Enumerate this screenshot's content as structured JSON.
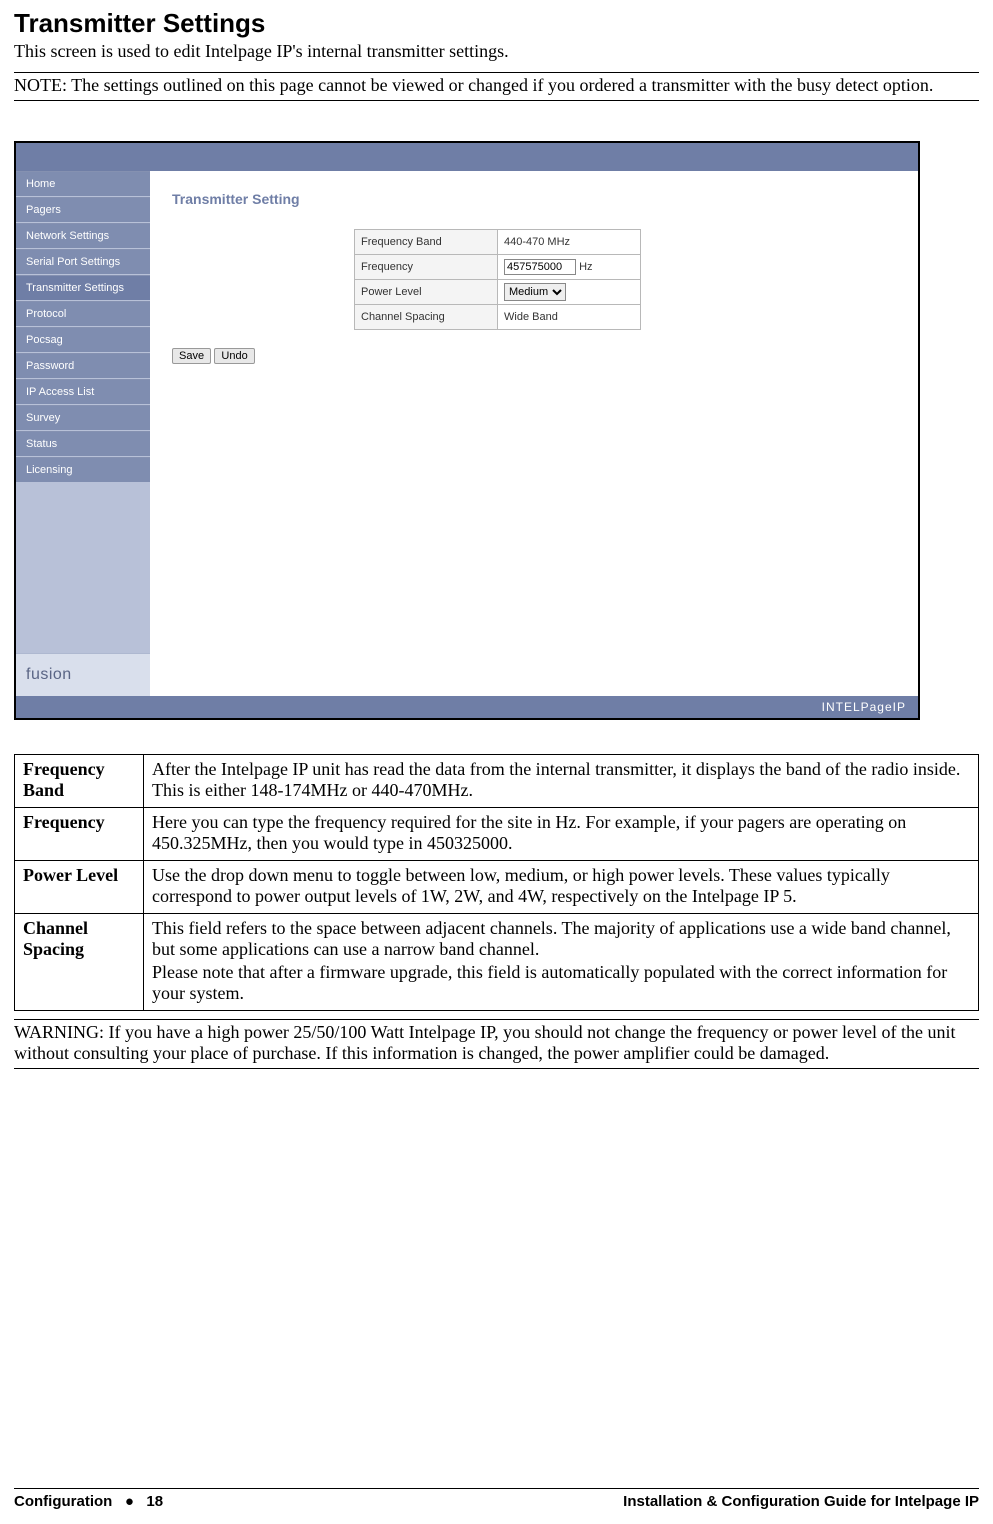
{
  "heading": "Transmitter Settings",
  "subtitle": "This screen is used to edit Intelpage IP's internal transmitter settings.",
  "note": "NOTE: The settings outlined on this page cannot be viewed or changed if you ordered a transmitter with the busy detect option.",
  "screenshot": {
    "nav": [
      "Home",
      "Pagers",
      "Network Settings",
      "Serial Port Settings",
      "Transmitter Settings",
      "Protocol",
      "Pocsag",
      "Password",
      "IP Access List",
      "Survey",
      "Status",
      "Licensing"
    ],
    "active_nav_index": 4,
    "logo": "fusion",
    "panel_title": "Transmitter Setting",
    "fields": {
      "freq_band_label": "Frequency Band",
      "freq_band_value": "440-470 MHz",
      "frequency_label": "Frequency",
      "frequency_value": "457575000",
      "frequency_unit": "Hz",
      "power_label": "Power Level",
      "power_value": "Medium",
      "spacing_label": "Channel Spacing",
      "spacing_value": "Wide Band"
    },
    "buttons": {
      "save": "Save",
      "undo": "Undo"
    },
    "footer_brand": "INTELPageIP"
  },
  "definitions": [
    {
      "term": "Frequency Band",
      "desc": [
        "After the Intelpage IP unit has read the data from the internal transmitter, it displays the band of the radio inside. This is either 148-174MHz or 440-470MHz."
      ]
    },
    {
      "term": "Frequency",
      "desc": [
        "Here you can type the frequency required for the site in Hz. For example, if your pagers are operating on 450.325MHz, then you would type in 450325000."
      ]
    },
    {
      "term": "Power Level",
      "desc": [
        "Use the drop down menu to toggle between low, medium, or high power levels. These values typically correspond to power output levels of 1W, 2W, and 4W, respectively on the Intelpage IP 5."
      ]
    },
    {
      "term": "Channel Spacing",
      "desc": [
        "This field refers to the space between adjacent channels. The majority of applications use a wide band channel, but some applications can use a narrow band channel.",
        "Please note that after a firmware upgrade, this field is automatically populated with the correct information for your system."
      ]
    }
  ],
  "warning": "WARNING: If you have a high power 25/50/100 Watt Intelpage IP, you should not change the frequency or power level of the unit without consulting your place of purchase. If this information is changed, the power amplifier could be damaged.",
  "footer": {
    "left_section": "Configuration",
    "page_number": "18",
    "right": "Installation & Configuration Guide for Intelpage IP"
  }
}
